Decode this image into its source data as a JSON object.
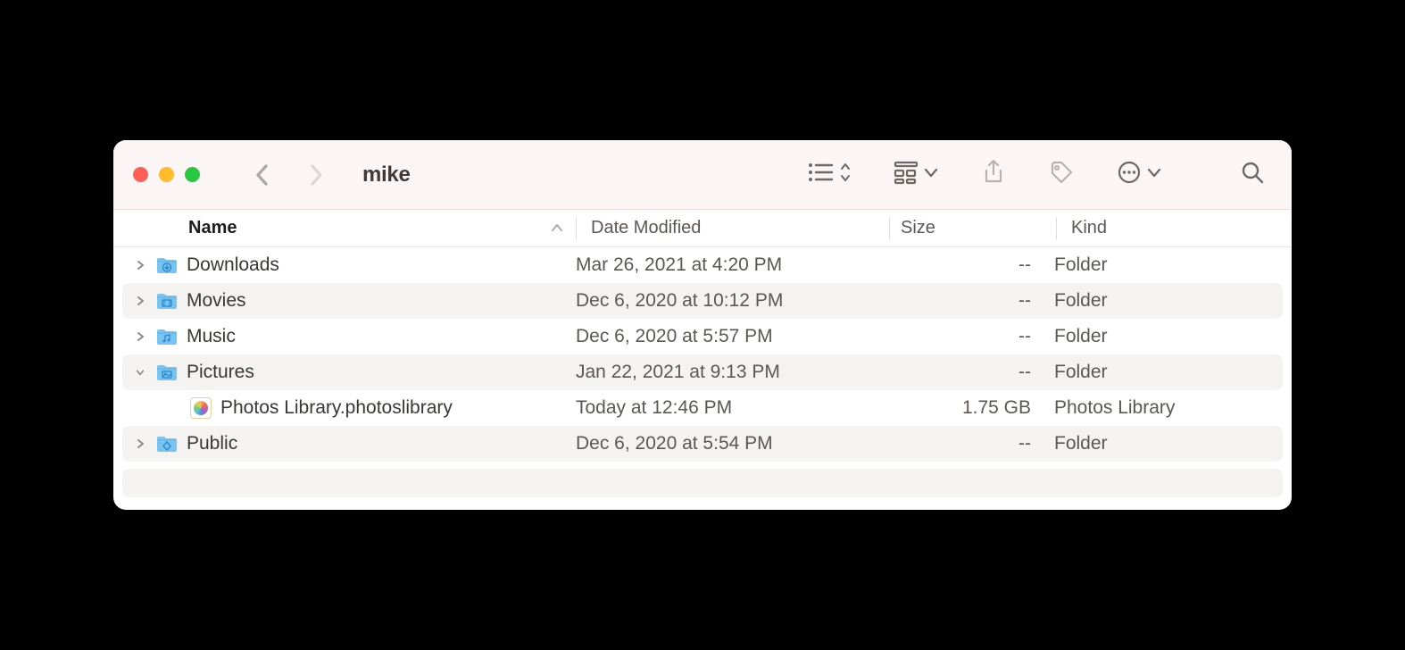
{
  "window_title": "mike",
  "columns": {
    "name": "Name",
    "date": "Date Modified",
    "size": "Size",
    "kind": "Kind"
  },
  "rows": [
    {
      "name": "Downloads",
      "date": "Mar 26, 2021 at 4:20 PM",
      "size": "--",
      "kind": "Folder",
      "type": "folder",
      "expanded": false,
      "depth": 0
    },
    {
      "name": "Movies",
      "date": "Dec 6, 2020 at 10:12 PM",
      "size": "--",
      "kind": "Folder",
      "type": "folder",
      "expanded": false,
      "depth": 0
    },
    {
      "name": "Music",
      "date": "Dec 6, 2020 at 5:57 PM",
      "size": "--",
      "kind": "Folder",
      "type": "folder",
      "expanded": false,
      "depth": 0
    },
    {
      "name": "Pictures",
      "date": "Jan 22, 2021 at 9:13 PM",
      "size": "--",
      "kind": "Folder",
      "type": "folder",
      "expanded": true,
      "depth": 0
    },
    {
      "name": "Photos Library.photoslibrary",
      "date": "Today at 12:46 PM",
      "size": "1.75 GB",
      "kind": "Photos Library",
      "type": "photoslib",
      "expanded": null,
      "depth": 1
    },
    {
      "name": "Public",
      "date": "Dec 6, 2020 at 5:54 PM",
      "size": "--",
      "kind": "Folder",
      "type": "folder",
      "expanded": false,
      "depth": 0
    }
  ]
}
